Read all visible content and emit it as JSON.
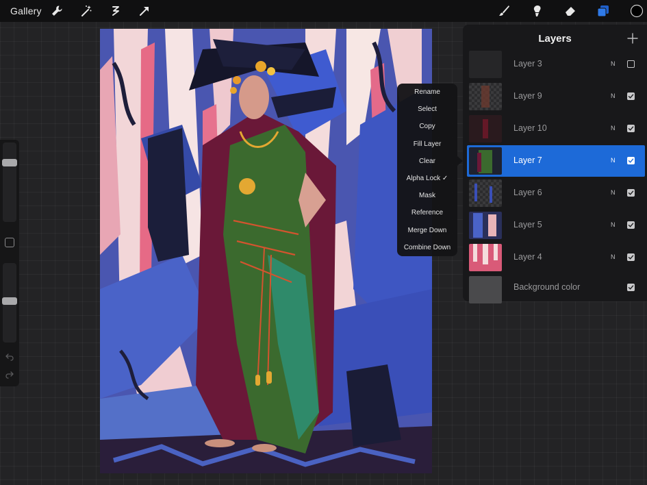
{
  "toolbar": {
    "gallery_label": "Gallery",
    "left_tools": [
      {
        "name": "wrench-icon"
      },
      {
        "name": "magic-wand-icon"
      },
      {
        "name": "selection-icon"
      },
      {
        "name": "transform-arrow-icon"
      }
    ],
    "right_tools": [
      {
        "name": "brush-icon"
      },
      {
        "name": "smudge-icon"
      },
      {
        "name": "eraser-icon"
      },
      {
        "name": "layers-icon"
      },
      {
        "name": "color-circle-icon"
      }
    ],
    "accent_color": "#2f6fd8",
    "active_color": "#000000"
  },
  "sidebar": {
    "brush_size_level": 0.77,
    "opacity_level": 0.52
  },
  "context_menu": {
    "items": [
      {
        "label": "Rename"
      },
      {
        "label": "Select"
      },
      {
        "label": "Copy"
      },
      {
        "label": "Fill Layer"
      },
      {
        "label": "Clear"
      },
      {
        "label": "Alpha Lock ✓"
      },
      {
        "label": "Mask"
      },
      {
        "label": "Reference"
      },
      {
        "label": "Merge Down"
      },
      {
        "label": "Combine Down"
      }
    ]
  },
  "layers_panel": {
    "title": "Layers",
    "selected_color": "#1d6ad8",
    "layers": [
      {
        "name": "Layer 3",
        "blend": "N",
        "visible": false
      },
      {
        "name": "Layer 9",
        "blend": "N",
        "visible": true
      },
      {
        "name": "Layer 10",
        "blend": "N",
        "visible": true
      },
      {
        "name": "Layer 7",
        "blend": "N",
        "visible": true,
        "selected": true
      },
      {
        "name": "Layer 6",
        "blend": "N",
        "visible": true
      },
      {
        "name": "Layer 5",
        "blend": "N",
        "visible": true
      },
      {
        "name": "Layer 4",
        "blend": "N",
        "visible": true
      },
      {
        "name": "Background color",
        "blend": "",
        "visible": true
      }
    ]
  }
}
